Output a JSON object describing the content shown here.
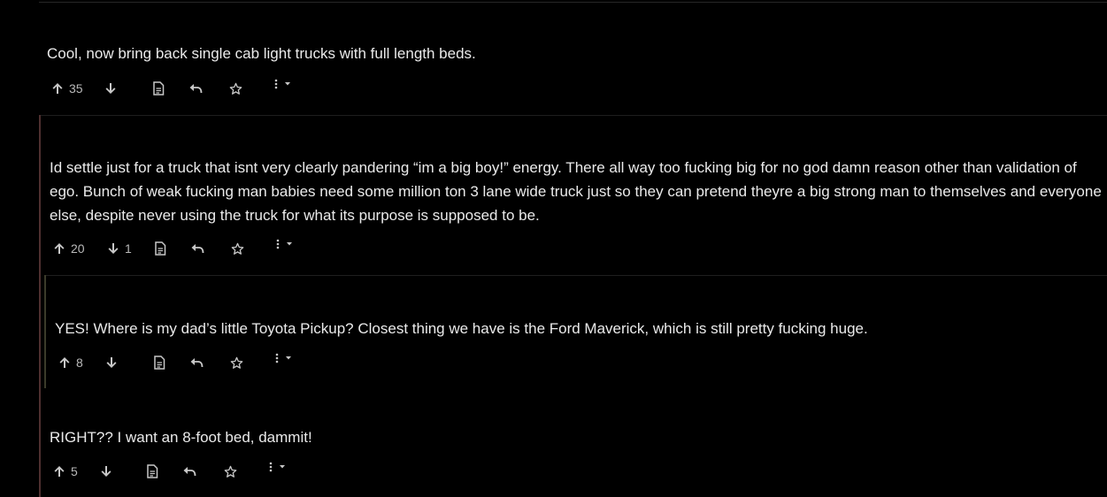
{
  "colors": {
    "background": "#000000",
    "text": "#eaeaea",
    "muted": "#b9b9b9",
    "thread_line_1": "#5a3a3a",
    "thread_line_2": "#4a4a3a"
  },
  "comments": [
    {
      "text": "Cool, now bring back single cab light trucks with full length beds.",
      "upvotes": "35",
      "downvotes": ""
    },
    {
      "text": "Id settle just for a truck that isnt very clearly pandering “im a big boy!” energy. There all way too fucking big for no god damn reason other than validation of ego. Bunch of weak fucking man babies need some million ton 3 lane wide truck just so they can pretend theyre a big strong man to themselves and everyone else, despite never using the truck for what its purpose is supposed to be.",
      "upvotes": "20",
      "downvotes": "1"
    },
    {
      "text": "YES! Where is my dad’s little Toyota Pickup? Closest thing we have is the Ford Maverick, which is still pretty fucking huge.",
      "upvotes": "8",
      "downvotes": ""
    },
    {
      "text": "RIGHT?? I want an 8-foot bed, dammit!",
      "upvotes": "5",
      "downvotes": ""
    }
  ],
  "icons": {
    "upvote": "arrow-up-icon",
    "downvote": "arrow-down-icon",
    "source": "document-icon",
    "reply": "reply-icon",
    "save": "star-icon",
    "more": "more-options-icon"
  }
}
